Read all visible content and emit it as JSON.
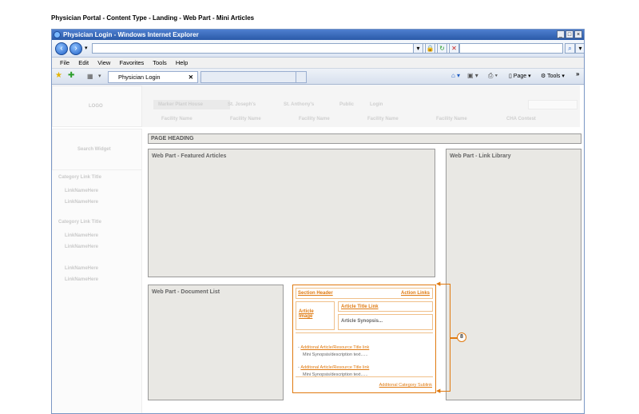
{
  "doc_title": "Physician Portal - Content Type - Landing - Web Part - Mini Articles",
  "browser": {
    "window_title": "Physician Login - Windows Internet Explorer",
    "menu": [
      "File",
      "Edit",
      "View",
      "Favorites",
      "Tools",
      "Help"
    ],
    "tab_label": "Physician Login",
    "page_label": "Page",
    "tools_label": "Tools"
  },
  "site": {
    "logo": "LOGO",
    "top_nav": [
      "Marker Plant House",
      "St. Joseph's",
      "St. Anthony's",
      "Public",
      "Login"
    ],
    "facility_nav": [
      "Facility Name",
      "Facility Name",
      "Facility Name",
      "Facility Name",
      "Facility Name",
      "CHA Contest"
    ],
    "search_widget": "Search Widget",
    "left_nav": [
      {
        "title": "Category Link Title",
        "links": [
          "LinkNameHere",
          "LinkNameHere"
        ]
      },
      {
        "title": "Category Link Title",
        "links": [
          "LinkNameHere",
          "LinkNameHere"
        ]
      },
      {
        "title": "",
        "links": [
          "LinkNameHere",
          "LinkNameHere"
        ]
      }
    ],
    "page_heading": "PAGE HEADING",
    "featured": "Web Part - Featured Articles",
    "link_library": "Web Part - Link Library",
    "document_list": "Web Part - Document List"
  },
  "mini_articles": {
    "section_header": "Section Header",
    "action_links": "Action Links",
    "article_image": "Article Image",
    "article_title": "Article Title Link",
    "article_synopsis": "Article Synopsis...",
    "additional": [
      {
        "title": "Additonal Article/Resource Title link",
        "synopsis": "Mini Synopsis/description text......"
      },
      {
        "title": "Additonal Article/Resource Title link",
        "synopsis": "Mini Synopsis/description text......"
      }
    ],
    "category_sublink": "Additonal Category Sublink",
    "callout": "8"
  }
}
